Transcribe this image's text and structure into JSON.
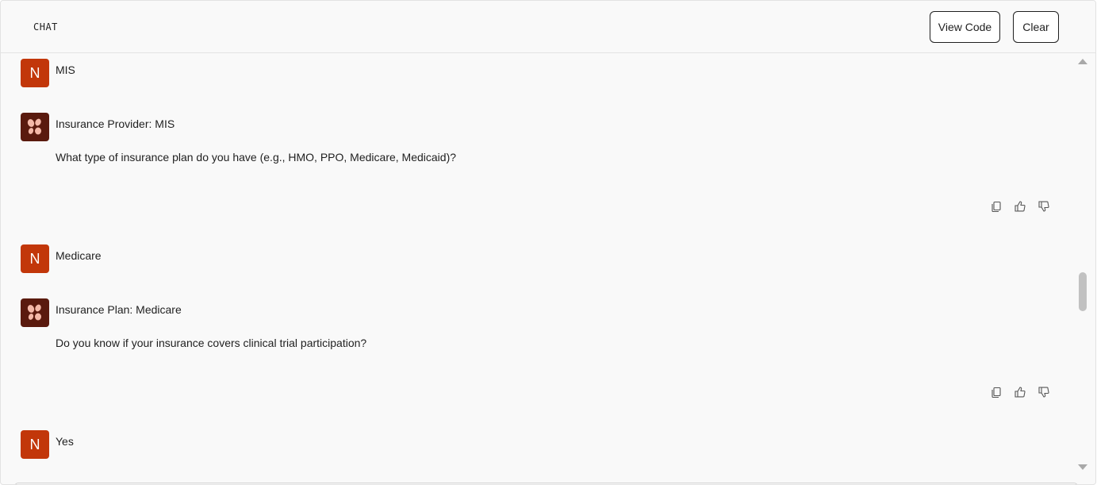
{
  "header": {
    "title": "CHAT",
    "view_code_label": "View Code",
    "clear_label": "Clear"
  },
  "messages": [
    {
      "role": "user",
      "avatar_letter": "N",
      "text": "MIS"
    },
    {
      "role": "assistant",
      "title": "Insurance Provider: MIS",
      "text": "What type of insurance plan do you have (e.g., HMO, PPO, Medicare, Medicaid)?"
    },
    {
      "role": "user",
      "avatar_letter": "N",
      "text": "Medicare"
    },
    {
      "role": "assistant",
      "title": "Insurance Plan: Medicare",
      "text": "Do you know if your insurance covers clinical trial participation?"
    },
    {
      "role": "user",
      "avatar_letter": "N",
      "text": "Yes"
    }
  ],
  "icons": {
    "copy": "copy-icon",
    "like": "thumbs-up-icon",
    "dislike": "thumbs-down-icon"
  },
  "colors": {
    "user_avatar": "#c2370a",
    "bot_avatar": "#5a1a0e",
    "background": "#f9f9f9"
  }
}
